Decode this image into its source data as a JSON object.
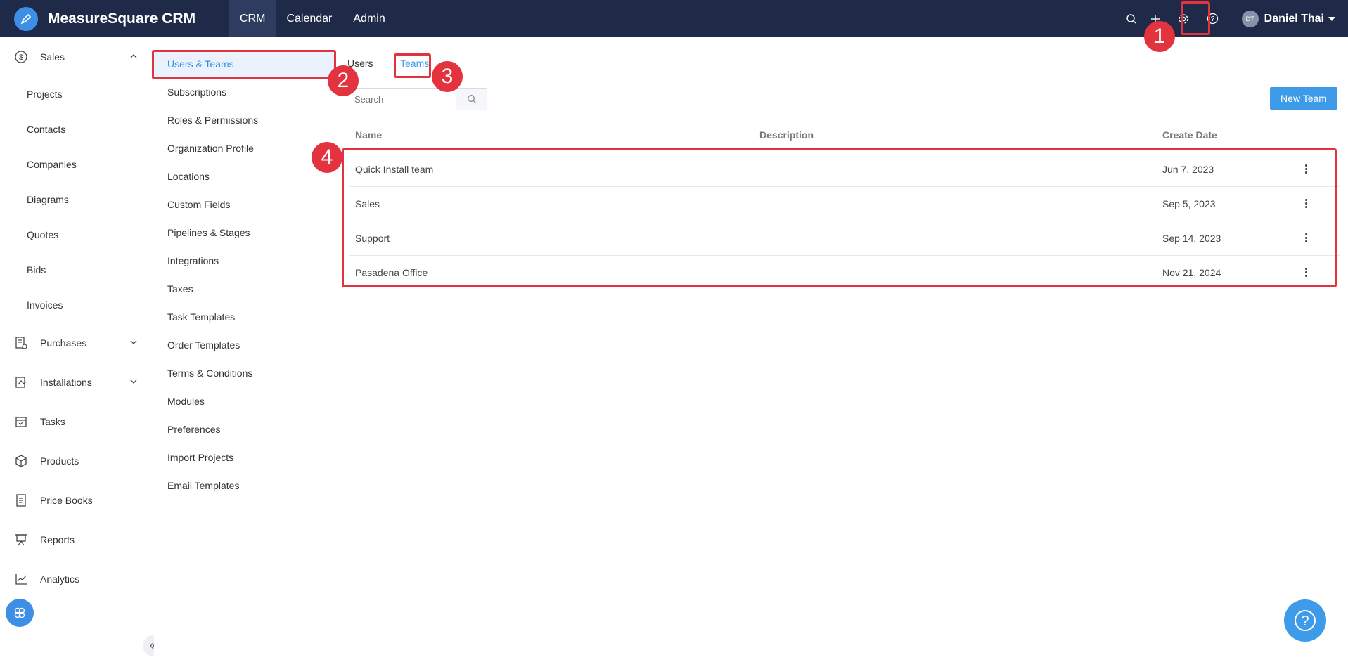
{
  "app": {
    "title": "MeasureSquare CRM"
  },
  "topnav": {
    "items": [
      "CRM",
      "Calendar",
      "Admin"
    ],
    "active": "CRM"
  },
  "user": {
    "initials": "DT",
    "name": "Daniel Thai"
  },
  "leftnav": {
    "sales": "Sales",
    "sales_items": [
      "Projects",
      "Contacts",
      "Companies",
      "Diagrams",
      "Quotes",
      "Bids",
      "Invoices"
    ],
    "purchases": "Purchases",
    "installations": "Installations",
    "tasks": "Tasks",
    "products": "Products",
    "price_books": "Price Books",
    "reports": "Reports",
    "analytics": "Analytics"
  },
  "settings_nav": {
    "items": [
      "Users & Teams",
      "Subscriptions",
      "Roles & Permissions",
      "Organization Profile",
      "Locations",
      "Custom Fields",
      "Pipelines & Stages",
      "Integrations",
      "Taxes",
      "Task Templates",
      "Order Templates",
      "Terms & Conditions",
      "Modules",
      "Preferences",
      "Import Projects",
      "Email Templates"
    ],
    "active": "Users & Teams"
  },
  "tabs": {
    "users": "Users",
    "teams": "Teams",
    "active": "Teams"
  },
  "search": {
    "placeholder": "Search"
  },
  "new_team_label": "New Team",
  "table": {
    "columns": {
      "name": "Name",
      "description": "Description",
      "create_date": "Create Date"
    },
    "rows": [
      {
        "name": "Quick Install team",
        "description": "",
        "create_date": "Jun 7, 2023"
      },
      {
        "name": "Sales",
        "description": "",
        "create_date": "Sep 5, 2023"
      },
      {
        "name": "Support",
        "description": "",
        "create_date": "Sep 14, 2023"
      },
      {
        "name": "Pasadena Office",
        "description": "",
        "create_date": "Nov 21, 2024"
      }
    ]
  },
  "annotations": {
    "badges": [
      "1",
      "2",
      "3",
      "4"
    ],
    "highlight_color": "#e2333f"
  },
  "colors": {
    "topbar": "#1e2a47",
    "accent": "#3d9bea"
  }
}
